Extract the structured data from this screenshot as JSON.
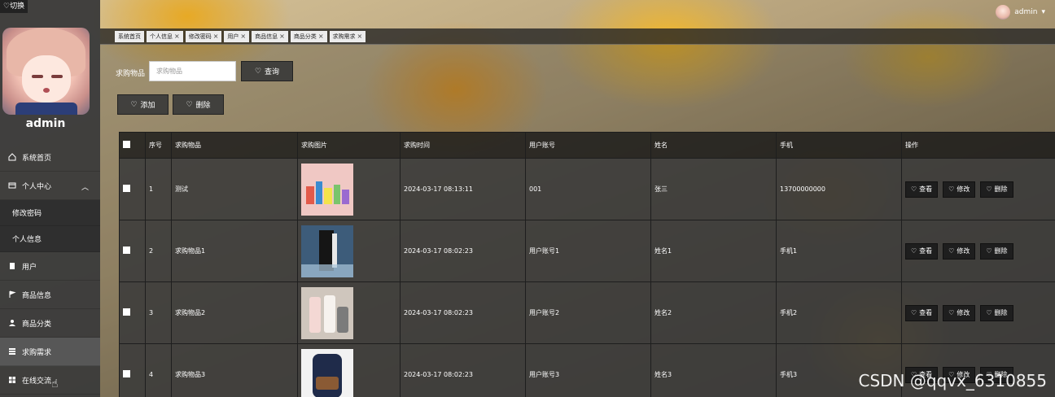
{
  "sidebar": {
    "switch_label": "♡切换",
    "admin_name": "admin",
    "menu": [
      {
        "label": "系统首页",
        "icon": "home-icon"
      },
      {
        "label": "个人中心",
        "icon": "profile-icon"
      },
      {
        "label": "修改密码"
      },
      {
        "label": "个人信息"
      },
      {
        "label": "用户",
        "icon": "clipboard-icon"
      },
      {
        "label": "商品信息",
        "icon": "flag-icon"
      },
      {
        "label": "商品分类",
        "icon": "person-icon"
      },
      {
        "label": "求购需求",
        "icon": "grid-icon"
      },
      {
        "label": "在线交流",
        "icon": "apps-icon"
      }
    ]
  },
  "header": {
    "username": "admin"
  },
  "tabs": [
    "系统首页",
    "个人信息",
    "修改密码",
    "用户",
    "商品信息",
    "商品分类",
    "求购需求"
  ],
  "search": {
    "label": "求购物品",
    "placeholder": "求购物品",
    "query_button": "查询",
    "add_button": "添加",
    "delete_button": "删除"
  },
  "table": {
    "headers": [
      "序号",
      "求购物品",
      "求购图片",
      "求购时间",
      "用户账号",
      "姓名",
      "手机",
      "操作"
    ],
    "rows": [
      {
        "no": "1",
        "item": "测试",
        "time": "2024-03-17 08:13:11",
        "account": "001",
        "name": "张三",
        "phone": "13700000000"
      },
      {
        "no": "2",
        "item": "求购物品1",
        "time": "2024-03-17 08:02:23",
        "account": "用户账号1",
        "name": "姓名1",
        "phone": "手机1"
      },
      {
        "no": "3",
        "item": "求购物品2",
        "time": "2024-03-17 08:02:23",
        "account": "用户账号2",
        "name": "姓名2",
        "phone": "手机2"
      },
      {
        "no": "4",
        "item": "求购物品3",
        "time": "2024-03-17 08:02:23",
        "account": "用户账号3",
        "name": "姓名3",
        "phone": "手机3"
      }
    ],
    "actions": {
      "view": "查看",
      "edit": "修改",
      "delete": "删除"
    }
  },
  "watermark": "CSDN @qqvx_6310855"
}
